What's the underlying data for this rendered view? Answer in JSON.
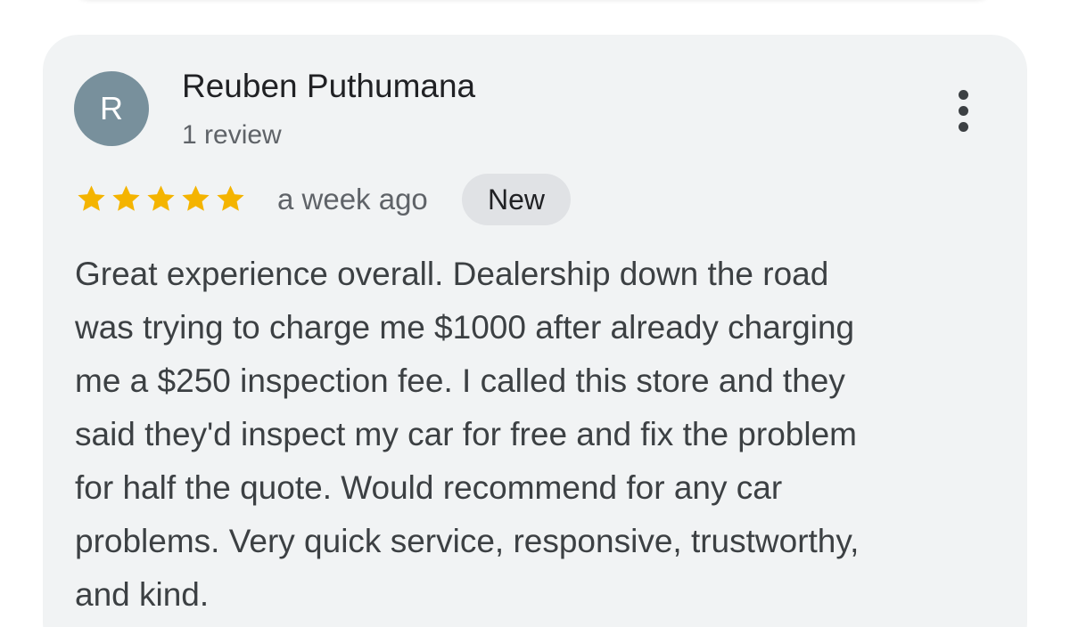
{
  "review": {
    "avatar_initial": "R",
    "author_name": "Reuben Puthumana",
    "author_review_count": "1 review",
    "rating": 5,
    "rating_max": 5,
    "star_color": "#f4b400",
    "date": "a week ago",
    "badge": "New",
    "text": "Great experience overall. Dealership down the road\nwas trying to charge me $1000 after already charging\nme a $250 inspection fee. I called this store and they\nsaid they'd inspect my car for free and fix the problem\nfor half the quote. Would recommend for any car\nproblems. Very quick service, responsive, trustworthy,\nand kind.",
    "more_icon": "more-vert-icon",
    "avatar_color": "#78909c"
  }
}
